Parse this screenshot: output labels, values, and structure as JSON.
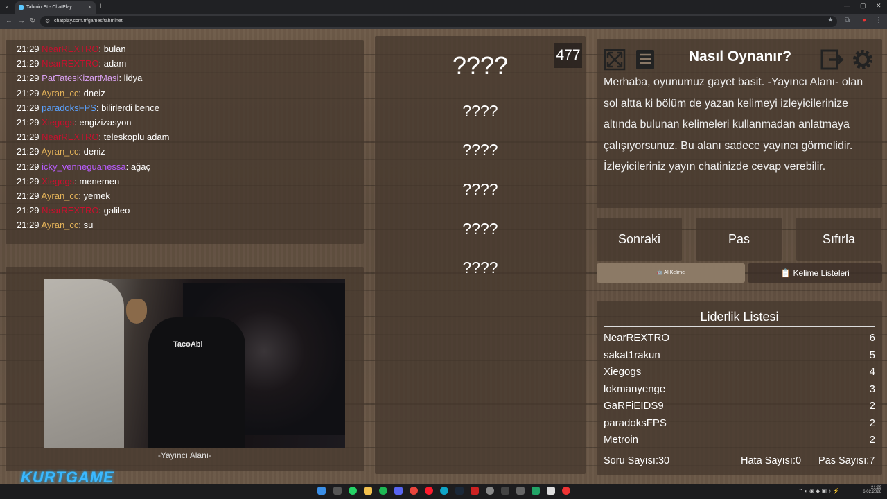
{
  "browser": {
    "tab_title": "Tahmin Et - ChatPlay",
    "url": "chatplay.com.tr/games/tahminet",
    "new_tab_glyph": "+",
    "close_glyph": "×",
    "minimize_glyph": "—",
    "maximize_glyph": "▢",
    "window_close_glyph": "✕"
  },
  "chat": {
    "messages": [
      {
        "time": "21:29",
        "user": "NearREXTRO",
        "user_color": "#c8102e",
        "text": ": bulan"
      },
      {
        "time": "21:29",
        "user": "NearREXTRO",
        "user_color": "#c8102e",
        "text": ": adam"
      },
      {
        "time": "21:29",
        "user": "PatTatesKizartMasi",
        "user_color": "#d9a0f0",
        "text": ": lidya"
      },
      {
        "time": "21:29",
        "user": "Ayran_cc",
        "user_color": "#e6b45a",
        "text": ": dneiz"
      },
      {
        "time": "21:29",
        "user": "paradoksFPS",
        "user_color": "#5aa2ff",
        "text": ": bilirlerdi bence"
      },
      {
        "time": "21:29",
        "user": "Xiegogs",
        "user_color": "#c8102e",
        "text": ": engizizasyon"
      },
      {
        "time": "21:29",
        "user": "NearREXTRO",
        "user_color": "#c8102e",
        "text": ": teleskoplu adam"
      },
      {
        "time": "21:29",
        "user": "Ayran_cc",
        "user_color": "#e6b45a",
        "text": ": deniz"
      },
      {
        "time": "21:29",
        "user": "icky_venneguanessa",
        "user_color": "#b95cff",
        "text": ": ağaç"
      },
      {
        "time": "21:29",
        "user": "Xiegogs",
        "user_color": "#c8102e",
        "text": ": menemen"
      },
      {
        "time": "21:29",
        "user": "Ayran_cc",
        "user_color": "#e6b45a",
        "text": ": yemek"
      },
      {
        "time": "21:29",
        "user": "NearREXTRO",
        "user_color": "#c8102e",
        "text": ": galileo"
      },
      {
        "time": "21:29",
        "user": "Ayran_cc",
        "user_color": "#e6b45a",
        "text": ": su"
      }
    ]
  },
  "camera": {
    "label": "-Yayıncı Alanı-",
    "shirt_text": "TacoAbi"
  },
  "words": {
    "main": "????",
    "list": [
      "????",
      "????",
      "????",
      "????",
      "????"
    ],
    "counter": "477"
  },
  "howto": {
    "title": "Nasıl Oynanır?",
    "text": "Merhaba, oyunumuz gayet basit. -Yayıncı Alanı- olan sol altta ki bölüm de yazan kelimeyi izleyicilerinize altında bulunan kelimeleri kullanmadan anlatmaya çalışıyorsunuz. Bu alanı sadece yayıncı görmelidir. İzleyicileriniz yayın chatinizde cevap verebilir."
  },
  "controls": {
    "next": "Sonraki",
    "pass": "Pas",
    "reset": "Sıfırla",
    "ai_words": "AI Kelime",
    "word_lists": "Kelime Listeleri"
  },
  "leaderboard": {
    "title": "Liderlik Listesi",
    "rows": [
      {
        "name": "NearREXTRO",
        "score": "6"
      },
      {
        "name": "sakat1rakun",
        "score": "5"
      },
      {
        "name": "Xiegogs",
        "score": "4"
      },
      {
        "name": "lokmanyenge",
        "score": "3"
      },
      {
        "name": "GaRFiEIDS9",
        "score": "2"
      },
      {
        "name": "paradoksFPS",
        "score": "2"
      },
      {
        "name": "Metroin",
        "score": "2"
      }
    ],
    "question_count": "Soru Sayısı:30",
    "error_count": "Hata Sayısı:0",
    "pass_count": "Pas Sayısı:7"
  },
  "overlay": {
    "logo": "KURTGAME"
  },
  "taskbar": {
    "time": "21:29",
    "date": "6.02.2026"
  },
  "icons": {
    "fullscreen": "fullscreen-icon",
    "notes": "notes-icon",
    "logout": "logout-icon",
    "settings": "gear-icon"
  },
  "colors": {
    "panel": "#46382d",
    "wood": "#665443"
  }
}
